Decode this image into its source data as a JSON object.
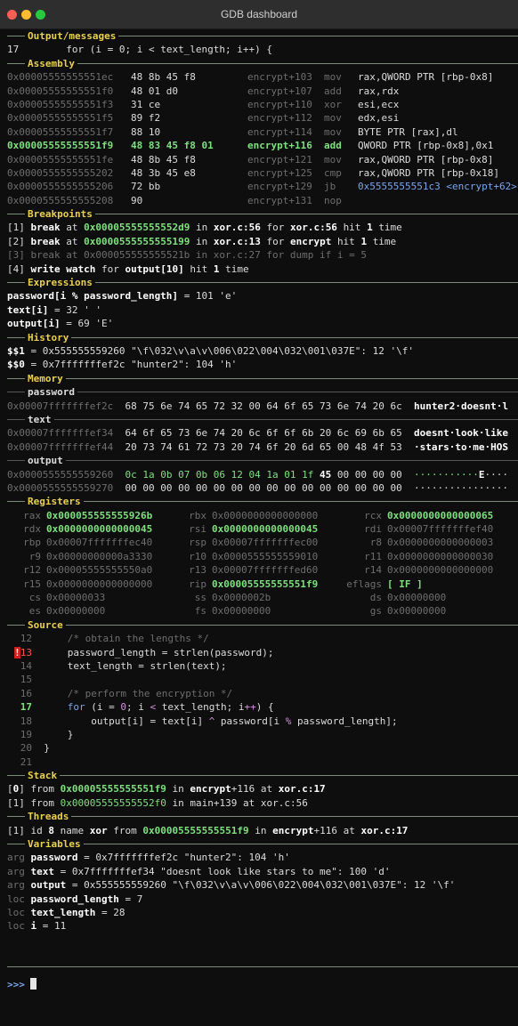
{
  "window": {
    "title": "GDB dashboard"
  },
  "sections": {
    "output": "Output/messages",
    "assembly": "Assembly",
    "breakpoints": "Breakpoints",
    "expressions": "Expressions",
    "history": "History",
    "memory": "Memory",
    "registers": "Registers",
    "source": "Source",
    "stack": "Stack",
    "threads": "Threads",
    "variables": "Variables"
  },
  "output": {
    "lineno": "17",
    "code": "for (i = 0; i < text_length; i++) {"
  },
  "assembly": [
    {
      "addr": "0x00005555555551ec",
      "bytes": "48 8b 45 f8",
      "sym": "encrypt+103",
      "mnem": "mov",
      "ops": "rax,QWORD PTR [rbp-0x8]",
      "current": false,
      "dimAddr": true
    },
    {
      "addr": "0x00005555555551f0",
      "bytes": "48 01 d0",
      "sym": "encrypt+107",
      "mnem": "add",
      "ops": "rax,rdx",
      "current": false,
      "dimAddr": true
    },
    {
      "addr": "0x00005555555551f3",
      "bytes": "31 ce",
      "sym": "encrypt+110",
      "mnem": "xor",
      "ops": "esi,ecx",
      "current": false,
      "dimAddr": true
    },
    {
      "addr": "0x00005555555551f5",
      "bytes": "89 f2",
      "sym": "encrypt+112",
      "mnem": "mov",
      "ops": "edx,esi",
      "current": false,
      "dimAddr": true
    },
    {
      "addr": "0x00005555555551f7",
      "bytes": "88 10",
      "sym": "encrypt+114",
      "mnem": "mov",
      "ops": "BYTE PTR [rax],dl",
      "current": false,
      "dimAddr": true
    },
    {
      "addr": "0x00005555555551f9",
      "bytes": "48 83 45 f8 01",
      "sym": "encrypt+116",
      "mnem": "add",
      "ops": "QWORD PTR [rbp-0x8],0x1",
      "current": true,
      "dimAddr": false
    },
    {
      "addr": "0x00005555555551fe",
      "bytes": "48 8b 45 f8",
      "sym": "encrypt+121",
      "mnem": "mov",
      "ops": "rax,QWORD PTR [rbp-0x8]",
      "current": false,
      "dimAddr": false
    },
    {
      "addr": "0x0000555555555202",
      "bytes": "48 3b 45 e8",
      "sym": "encrypt+125",
      "mnem": "cmp",
      "ops": "rax,QWORD PTR [rbp-0x18]",
      "current": false,
      "dimAddr": false
    },
    {
      "addr": "0x0000555555555206",
      "bytes": "72 bb",
      "sym": "encrypt+129",
      "mnem": "jb",
      "ops": "0x5555555551c3 <encrypt+62>",
      "current": false,
      "dimAddr": false
    },
    {
      "addr": "0x0000555555555208",
      "bytes": "90",
      "sym": "encrypt+131",
      "mnem": "nop",
      "ops": "",
      "current": false,
      "dimAddr": false
    }
  ],
  "breakpoints": {
    "b1": {
      "num": "1",
      "kind": "break",
      "at": "at",
      "addr": "0x00005555555552d9",
      "in": "in",
      "func": "xor.c:56",
      "for": "for",
      "loc": "xor.c:56",
      "hit": "hit",
      "count": "1",
      "time": "time"
    },
    "b2": {
      "num": "2",
      "kind": "break",
      "at": "at",
      "addr": "0x0000555555555199",
      "in": "in",
      "func": "xor.c:13",
      "for": "for",
      "loc": "encrypt",
      "hit": "hit",
      "count": "1",
      "time": "time"
    },
    "b3": {
      "text": "break at 0x000055555555521b in xor.c:27 for dump if i = 5",
      "num": "3"
    },
    "b4": {
      "num": "4",
      "kind": "write watch",
      "for": "for",
      "expr": "output[10]",
      "hit": "hit",
      "count": "1",
      "time": "time"
    }
  },
  "expressions": [
    {
      "expr": "password[i % password_length]",
      "val": "= 101 'e'"
    },
    {
      "expr": "text[i]",
      "val": "= 32 ' '"
    },
    {
      "expr": "output[i]",
      "val": "= 69 'E'"
    }
  ],
  "history": [
    {
      "name": "$$1",
      "val": "= 0x555555559260 \"\\f\\032\\v\\a\\v\\006\\022\\004\\032\\001\\037E\": 12 '\\f'"
    },
    {
      "name": "$$0",
      "val": "= 0x7fffffffef2c \"hunter2\": 104 'h'"
    }
  ],
  "memory": {
    "password": {
      "label": "password",
      "rows": [
        {
          "addr": "0x00007fffffffef2c",
          "hex": "68 75 6e 74 65 72 32 00 64 6f 65 73 6e 74 20 6c",
          "ascii": "hunter2·doesnt·l"
        }
      ]
    },
    "text": {
      "label": "text",
      "rows": [
        {
          "addr": "0x00007fffffffef34",
          "hex": "64 6f 65 73 6e 74 20 6c 6f 6f 6b 20 6c 69 6b 65",
          "ascii": "doesnt·look·like"
        },
        {
          "addr": "0x00007fffffffef44",
          "hex": "20 73 74 61 72 73 20 74 6f 20 6d 65 00 48 4f 53",
          "ascii": "·stars·to·me·HOS"
        }
      ]
    },
    "output": {
      "label": "output",
      "rows": [
        {
          "addr": "0x0000555555559260",
          "hex1": "0c 1a 0b 07 0b 06 12 04 1a 01 1f",
          "hex2": "45",
          "hex3": "00 00 00 00",
          "ascii1": "···········",
          "ascii2": "E",
          "ascii3": "····"
        },
        {
          "addr": "0x0000555555559270",
          "hex1": "00 00 00 00 00 00 00 00 00 00 00 00 00 00 00 00",
          "hex2": "",
          "hex3": "",
          "ascii1": "················",
          "ascii2": "",
          "ascii3": ""
        }
      ]
    }
  },
  "registers": [
    [
      {
        "n": "rax",
        "v": "0x000055555555926b",
        "hl": true
      },
      {
        "n": "rbx",
        "v": "0x0000000000000000",
        "hl": false
      },
      {
        "n": "rcx",
        "v": "0x0000000000000065",
        "hl": true
      }
    ],
    [
      {
        "n": "rdx",
        "v": "0x0000000000000045",
        "hl": true
      },
      {
        "n": "rsi",
        "v": "0x0000000000000045",
        "hl": true
      },
      {
        "n": "rdi",
        "v": "0x00007fffffffef40",
        "hl": false
      }
    ],
    [
      {
        "n": "rbp",
        "v": "0x00007fffffffec40",
        "hl": false
      },
      {
        "n": "rsp",
        "v": "0x00007fffffffec00",
        "hl": false
      },
      {
        "n": "r8",
        "v": "0x0000000000000003",
        "hl": false
      }
    ],
    [
      {
        "n": "r9",
        "v": "0x00000000000a3330",
        "hl": false
      },
      {
        "n": "r10",
        "v": "0x0000555555559010",
        "hl": false
      },
      {
        "n": "r11",
        "v": "0x0000000000000030",
        "hl": false
      }
    ],
    [
      {
        "n": "r12",
        "v": "0x00005555555550a0",
        "hl": false
      },
      {
        "n": "r13",
        "v": "0x00007fffffffed60",
        "hl": false
      },
      {
        "n": "r14",
        "v": "0x0000000000000000",
        "hl": false
      }
    ],
    [
      {
        "n": "r15",
        "v": "0x0000000000000000",
        "hl": false
      },
      {
        "n": "rip",
        "v": "0x00005555555551f9",
        "hl": true
      },
      {
        "n": "eflags",
        "v": "[ IF ]",
        "hl": true
      }
    ],
    [
      {
        "n": "cs",
        "v": "0x00000033",
        "hl": false
      },
      {
        "n": "ss",
        "v": "0x0000002b",
        "hl": false
      },
      {
        "n": "ds",
        "v": "0x00000000",
        "hl": false
      }
    ],
    [
      {
        "n": "es",
        "v": "0x00000000",
        "hl": false
      },
      {
        "n": "fs",
        "v": "0x00000000",
        "hl": false
      },
      {
        "n": "gs",
        "v": "0x00000000",
        "hl": false
      }
    ]
  ],
  "source": {
    "l12": {
      "no": "12",
      "comment": "/* obtain the lengths */"
    },
    "l13": {
      "no": "13",
      "code": "password_length = strlen(password);"
    },
    "l14": {
      "no": "14",
      "code": "text_length = strlen(text);"
    },
    "l15": {
      "no": "15"
    },
    "l16": {
      "no": "16",
      "comment": "/* perform the encryption */"
    },
    "l17": {
      "no": "17",
      "kw": "for",
      "a": " (i = ",
      "zero": "0",
      "b": "; i ",
      "lt": "<",
      "c": " text_length; i",
      "pp": "++",
      "d": ") {"
    },
    "l18": {
      "no": "18",
      "a": "output[i] = text[i] ",
      "xor": "^",
      "b": " password[i ",
      "mod": "%",
      "c": " password_length];"
    },
    "l19": {
      "no": "19",
      "code": "}"
    },
    "l20": {
      "no": "20",
      "code": "}"
    },
    "l21": {
      "no": "21"
    }
  },
  "stack": [
    {
      "num": "0",
      "from": "from",
      "addr": "0x00005555555551f9",
      "in": "in",
      "func": "encrypt",
      "off": "+116",
      "at": "at",
      "loc": "xor.c:17"
    },
    {
      "num": "1",
      "from": "from",
      "addr": "0x00005555555552f0",
      "in": "in",
      "func": "main",
      "off": "+139",
      "at": "at",
      "loc": "xor.c:56"
    }
  ],
  "threads": {
    "num": "1",
    "id": "id",
    "idnum": "8",
    "name": "name",
    "tname": "xor",
    "from": "from",
    "addr": "0x00005555555551f9",
    "in": "in",
    "func": "encrypt",
    "off": "+116",
    "at": "at",
    "loc": "xor.c:17"
  },
  "variables": [
    {
      "kind": "arg",
      "name": "password",
      "val": "= 0x7fffffffef2c \"hunter2\": 104 'h'"
    },
    {
      "kind": "arg",
      "name": "text",
      "val": "= 0x7fffffffef34 \"doesnt look like stars to me\": 100 'd'"
    },
    {
      "kind": "arg",
      "name": "output",
      "val": "= 0x555555559260 \"\\f\\032\\v\\a\\v\\006\\022\\004\\032\\001\\037E\": 12 '\\f'"
    },
    {
      "kind": "loc",
      "name": "password_length",
      "val": "= 7"
    },
    {
      "kind": "loc",
      "name": "text_length",
      "val": "= 28"
    },
    {
      "kind": "loc",
      "name": "i",
      "val": "= 11"
    }
  ],
  "prompt": ">>>"
}
